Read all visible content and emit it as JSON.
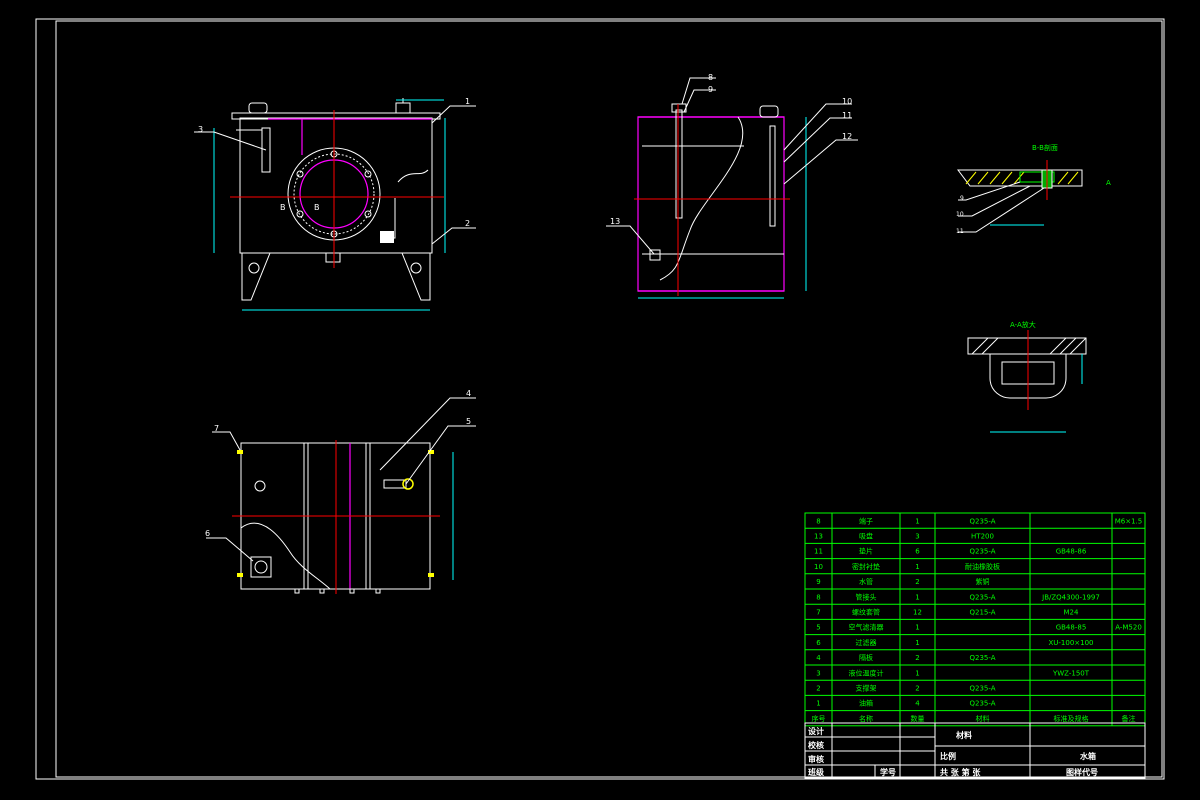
{
  "drawing": {
    "colors": {
      "background": "#000000",
      "outline": "#ffffff",
      "centerline": "#ff0000",
      "dimension": "#00ffff",
      "hidden": "#ff00ff",
      "annotation": "#00ff00",
      "weld": "#ffff00"
    },
    "front_view": {
      "callouts": [
        "1",
        "2",
        "3"
      ],
      "section_labels": [
        "B",
        "B"
      ]
    },
    "side_view": {
      "callouts": [
        "8",
        "9",
        "10",
        "11",
        "12",
        "13"
      ]
    },
    "plan_view": {
      "callouts": [
        "4",
        "5",
        "6",
        "7"
      ]
    },
    "detail_views": {
      "section_view_title": "B-B剖面",
      "section_marker": "A",
      "enlarged_view_title": "A-A放大",
      "callouts": [
        "9",
        "10",
        "11"
      ]
    }
  },
  "parts_list": {
    "rows": [
      [
        "8",
        "端子",
        "1",
        "Q235-A",
        "",
        "M6×1.5"
      ],
      [
        "13",
        "吸盘",
        "3",
        "HT200",
        "",
        ""
      ],
      [
        "11",
        "垫片",
        "6",
        "Q235-A",
        "GB48-86",
        ""
      ],
      [
        "10",
        "密封衬垫",
        "1",
        "耐油橡胶板",
        "",
        ""
      ],
      [
        "9",
        "水管",
        "2",
        "紫铜",
        "",
        ""
      ],
      [
        "8",
        "管接头",
        "1",
        "Q235-A",
        "JB/ZQ4300-1997",
        ""
      ],
      [
        "7",
        "螺纹套管",
        "12",
        "Q215-A",
        "M24",
        ""
      ],
      [
        "5",
        "空气滤清器",
        "1",
        "",
        "GB48-85",
        "A-M520"
      ],
      [
        "6",
        "过滤器",
        "1",
        "",
        "XU-100×100",
        ""
      ],
      [
        "4",
        "隔板",
        "2",
        "Q235-A",
        "",
        ""
      ],
      [
        "3",
        "液位温度计",
        "1",
        "",
        "YWZ-150T",
        ""
      ],
      [
        "2",
        "支撑架",
        "2",
        "Q235-A",
        "",
        ""
      ],
      [
        "1",
        "油箱",
        "4",
        "Q235-A",
        "",
        ""
      ]
    ],
    "header": [
      "序号",
      "名称",
      "数量",
      "材料",
      "标准及规格",
      "备注"
    ]
  },
  "title_block": {
    "left_labels": [
      "设计",
      "校核",
      "审核",
      "班级"
    ],
    "student_no_label": "学号",
    "material_label": "材料",
    "scale_label": "比例",
    "drawing_name": "水箱",
    "sheet_label": "共  张 第  张",
    "drawing_code_label": "图样代号"
  }
}
